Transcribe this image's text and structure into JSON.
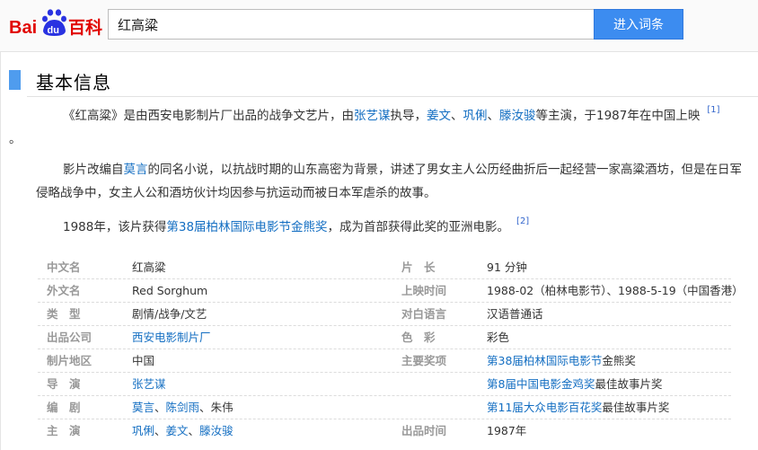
{
  "header": {
    "logo": {
      "bai": "Bai",
      "du": "du",
      "baike": "百科"
    },
    "search_value": "红高粱",
    "search_button_label": "进入词条"
  },
  "section": {
    "title": "基本信息"
  },
  "paragraphs": {
    "p1": {
      "t1": "《红高粱》是由西安电影制片厂出品的战争文艺片，由",
      "director": "张艺谋",
      "t2": "执导，",
      "actor1": "姜文",
      "c1": "、",
      "actor2": "巩俐",
      "c2": "、",
      "actor3": "滕汝骏",
      "t3": "等主演，于1987年在中国上映",
      "ref": "[1]",
      "t4": "。"
    },
    "p2": {
      "t1": "影片改编自",
      "author": "莫言",
      "t2": "的同名小说，以抗战时期的山东高密为背景，讲述了男女主人公历经曲折后一起经营一家高粱酒坊，但是在日军侵略战争中，女主人公和酒坊伙计均因参与抗运动而被日本军虐杀的故事。"
    },
    "p3": {
      "t1": "1988年，该片获得",
      "award": "第38届柏林国际电影节金熊奖",
      "t2": "，成为首部获得此奖的亚洲电影。",
      "ref": "[2]"
    }
  },
  "info": {
    "rows": [
      {
        "l1": "中文名",
        "v1": "红高粱",
        "l2": "片　长",
        "v2": "91 分钟"
      },
      {
        "l1": "外文名",
        "v1": "Red Sorghum",
        "l2": "上映时间",
        "v2": "1988-02（柏林电影节）、1988-5-19（中国香港）"
      },
      {
        "l1": "类　型",
        "v1": "剧情/战争/文艺",
        "l2": "对白语言",
        "v2": "汉语普通话"
      },
      {
        "l1": "出品公司",
        "v1": "西安电影制片厂",
        "l2": "色　彩",
        "v2": "彩色"
      },
      {
        "l1": "制片地区",
        "v1": "中国",
        "l2": "主要奖项",
        "v2_link": "第38届柏林国际电影节",
        "v2_rest": "金熊奖"
      },
      {
        "l1": "导　演",
        "v1": "张艺谋",
        "v2_link": "第8届中国电影金鸡奖",
        "v2_rest": "最佳故事片奖"
      },
      {
        "l1": "编　剧",
        "v1_a": "莫言",
        "v1_b": "陈剑雨",
        "v1_c": "朱伟",
        "sep": "、",
        "v2_link": "第11届大众电影百花奖",
        "v2_rest": "最佳故事片奖"
      },
      {
        "l1": "主　演",
        "v1_a": "巩俐",
        "v1_b": "姜文",
        "v1_c": "滕汝骏",
        "sep": "、",
        "l2": "出品时间",
        "v2": "1987年"
      }
    ]
  },
  "colors": {
    "accent": "#3c8cf0",
    "link": "#136ec2",
    "logo_red": "#e10602",
    "logo_blue": "#2932e1",
    "section_bar": "#4f9cee"
  }
}
